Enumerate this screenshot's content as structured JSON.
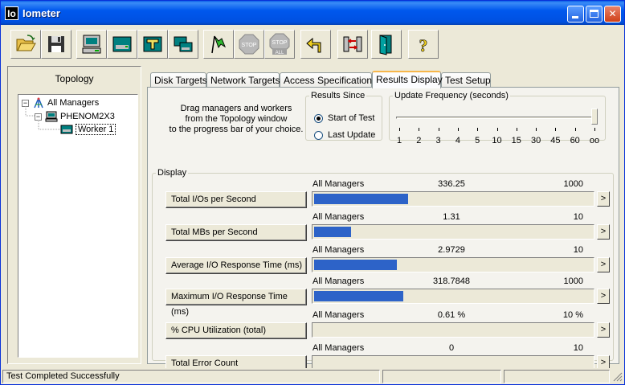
{
  "window": {
    "title": "Iometer",
    "icon_text": "Io"
  },
  "toolbar": {
    "buttons": [
      {
        "name": "open-config",
        "icon": "folder-icon"
      },
      {
        "name": "save-config",
        "icon": "floppy-icon"
      },
      {
        "name": "start-new-manager",
        "icon": "computer-icon"
      },
      {
        "name": "start-new-disk-worker",
        "icon": "disk-worker-icon"
      },
      {
        "name": "start-new-network-worker",
        "icon": "network-worker-icon"
      },
      {
        "name": "duplicate-worker",
        "icon": "duplicate-icon"
      },
      {
        "name": "start-tests",
        "icon": "green-flag-icon"
      },
      {
        "name": "stop-test",
        "icon": "stop-sign-icon",
        "label": "STOP"
      },
      {
        "name": "stop-all",
        "icon": "stop-all-icon",
        "label": "STOP",
        "sub_label": "ALL"
      },
      {
        "name": "reset-workers",
        "icon": "reset-arrow-icon"
      },
      {
        "name": "disconnect-manager",
        "icon": "disconnect-icon"
      },
      {
        "name": "exit",
        "icon": "exit-door-icon"
      },
      {
        "name": "about",
        "icon": "help-question-icon",
        "label": "?"
      }
    ]
  },
  "topology": {
    "title": "Topology",
    "root": {
      "label": "All Managers",
      "expander": "−"
    },
    "manager": {
      "label": "PHENOM2X3",
      "expander": "−"
    },
    "worker": {
      "label": "Worker 1"
    }
  },
  "tabs": [
    {
      "label": "Disk Targets",
      "active": false
    },
    {
      "label": "Network Targets",
      "active": false
    },
    {
      "label": "Access Specifications",
      "active": false
    },
    {
      "label": "Results Display",
      "active": true
    },
    {
      "label": "Test Setup",
      "active": false
    }
  ],
  "results": {
    "drag_hint": [
      "Drag managers and workers",
      "from the Topology window",
      "to the progress bar of your choice."
    ],
    "results_since": {
      "legend": "Results Since",
      "options": [
        {
          "label": "Start of Test",
          "checked": true
        },
        {
          "label": "Last Update",
          "checked": false
        }
      ]
    },
    "update_frequency": {
      "legend": "Update Frequency (seconds)",
      "ticks": [
        "1",
        "2",
        "3",
        "4",
        "5",
        "10",
        "15",
        "30",
        "45",
        "60",
        "oo"
      ],
      "selected": "oo"
    },
    "display": {
      "legend": "Display",
      "metrics": [
        {
          "label": "Total I/Os per Second",
          "manager": "All Managers",
          "value": "336.25",
          "max": "1000",
          "fraction": 0.336
        },
        {
          "label": "Total MBs per Second",
          "manager": "All Managers",
          "value": "1.31",
          "max": "10",
          "fraction": 0.131
        },
        {
          "label": "Average I/O Response Time (ms)",
          "manager": "All Managers",
          "value": "2.9729",
          "max": "10",
          "fraction": 0.297
        },
        {
          "label": "Maximum I/O Response Time (ms)",
          "manager": "All Managers",
          "value": "318.7848",
          "max": "1000",
          "fraction": 0.319
        },
        {
          "label": "% CPU Utilization (total)",
          "manager": "All Managers",
          "value": "0.61 %",
          "max": "10 %",
          "fraction": 0.0
        },
        {
          "label": "Total Error Count",
          "manager": "All Managers",
          "value": "0",
          "max": "10",
          "fraction": 0.0
        }
      ],
      "arrow": ">"
    }
  },
  "status": {
    "text": "Test Completed Successfully"
  },
  "colors": {
    "bar_fill": "#2d63c8",
    "title_bar": "#0058ee",
    "tab_highlight": "#f7b64a"
  }
}
